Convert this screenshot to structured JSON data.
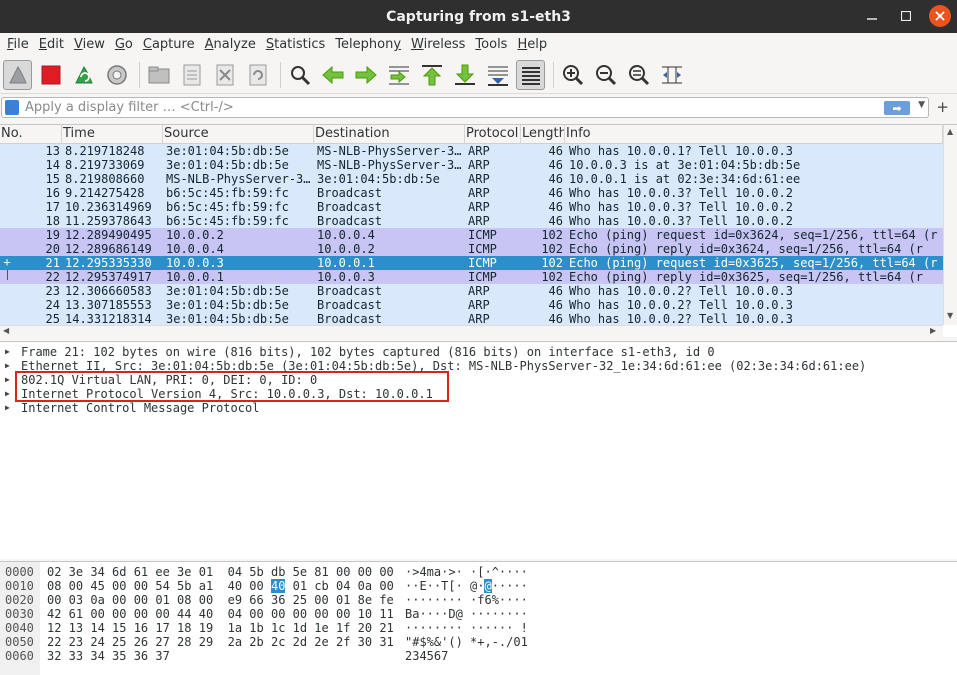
{
  "window": {
    "title": "Capturing from s1-eth3",
    "minimize_icon": "minimize-icon",
    "maximize_icon": "maximize-icon",
    "close_icon": "close-icon"
  },
  "menu": [
    {
      "label": "File",
      "mnemonic": "F",
      "rest": "ile"
    },
    {
      "label": "Edit",
      "mnemonic": "E",
      "rest": "dit"
    },
    {
      "label": "View",
      "mnemonic": "V",
      "rest": "iew"
    },
    {
      "label": "Go",
      "mnemonic": "G",
      "rest": "o"
    },
    {
      "label": "Capture",
      "mnemonic": "C",
      "rest": "apture"
    },
    {
      "label": "Analyze",
      "mnemonic": "A",
      "rest": "nalyze"
    },
    {
      "label": "Statistics",
      "mnemonic": "S",
      "rest": "tatistics"
    },
    {
      "label": "Telephony",
      "mnemonic": "y",
      "rest": "Telephon"
    },
    {
      "label": "Wireless",
      "mnemonic": "W",
      "rest": "ireless"
    },
    {
      "label": "Tools",
      "mnemonic": "T",
      "rest": "ools"
    },
    {
      "label": "Help",
      "mnemonic": "H",
      "rest": "elp"
    }
  ],
  "toolbar": {
    "icons": [
      "start-capture-icon",
      "stop-capture-icon",
      "restart-capture-icon",
      "capture-options-icon",
      "open-file-icon",
      "save-file-icon",
      "close-file-icon",
      "reload-file-icon",
      "find-packet-icon",
      "go-back-icon",
      "go-forward-icon",
      "go-to-packet-icon",
      "first-packet-icon",
      "last-packet-icon",
      "autoscroll-icon",
      "colorize-icon",
      "zoom-in-icon",
      "zoom-out-icon",
      "normal-size-icon",
      "resize-columns-icon"
    ]
  },
  "filter": {
    "placeholder": "Apply a display filter … <Ctrl-/>",
    "value": "",
    "apply_icon": "apply-filter-icon",
    "add_icon": "+"
  },
  "packet_list": {
    "columns": [
      "No.",
      "Time",
      "Source",
      "Destination",
      "Protocol",
      "Length",
      "Info"
    ],
    "rows": [
      {
        "no": "13",
        "time": "8.219718248",
        "src": "3e:01:04:5b:db:5e",
        "dst": "MS-NLB-PhysServer-3…",
        "proto": "ARP",
        "len": "46",
        "info": "Who has 10.0.0.1? Tell 10.0.0.3",
        "kind": "arp"
      },
      {
        "no": "14",
        "time": "8.219733069",
        "src": "3e:01:04:5b:db:5e",
        "dst": "MS-NLB-PhysServer-3…",
        "proto": "ARP",
        "len": "46",
        "info": "10.0.0.3 is at 3e:01:04:5b:db:5e",
        "kind": "arp"
      },
      {
        "no": "15",
        "time": "8.219808660",
        "src": "MS-NLB-PhysServer-3…",
        "dst": "3e:01:04:5b:db:5e",
        "proto": "ARP",
        "len": "46",
        "info": "10.0.0.1 is at 02:3e:34:6d:61:ee",
        "kind": "arp"
      },
      {
        "no": "16",
        "time": "9.214275428",
        "src": "b6:5c:45:fb:59:fc",
        "dst": "Broadcast",
        "proto": "ARP",
        "len": "46",
        "info": "Who has 10.0.0.3? Tell 10.0.0.2",
        "kind": "arp"
      },
      {
        "no": "17",
        "time": "10.236314969",
        "src": "b6:5c:45:fb:59:fc",
        "dst": "Broadcast",
        "proto": "ARP",
        "len": "46",
        "info": "Who has 10.0.0.3? Tell 10.0.0.2",
        "kind": "arp"
      },
      {
        "no": "18",
        "time": "11.259378643",
        "src": "b6:5c:45:fb:59:fc",
        "dst": "Broadcast",
        "proto": "ARP",
        "len": "46",
        "info": "Who has 10.0.0.3? Tell 10.0.0.2",
        "kind": "arp"
      },
      {
        "no": "19",
        "time": "12.289490495",
        "src": "10.0.0.2",
        "dst": "10.0.0.4",
        "proto": "ICMP",
        "len": "102",
        "info": "Echo (ping) request  id=0x3624, seq=1/256, ttl=64 (r",
        "kind": "icmp"
      },
      {
        "no": "20",
        "time": "12.289686149",
        "src": "10.0.0.4",
        "dst": "10.0.0.2",
        "proto": "ICMP",
        "len": "102",
        "info": "Echo (ping) reply    id=0x3624, seq=1/256, ttl=64 (r",
        "kind": "icmp"
      },
      {
        "no": "21",
        "time": "12.295335330",
        "src": "10.0.0.3",
        "dst": "10.0.0.1",
        "proto": "ICMP",
        "len": "102",
        "info": "Echo (ping) request  id=0x3625, seq=1/256, ttl=64 (r",
        "kind": "sel"
      },
      {
        "no": "22",
        "time": "12.295374917",
        "src": "10.0.0.1",
        "dst": "10.0.0.3",
        "proto": "ICMP",
        "len": "102",
        "info": "Echo (ping) reply    id=0x3625, seq=1/256, ttl=64 (r",
        "kind": "icmp"
      },
      {
        "no": "23",
        "time": "12.306660583",
        "src": "3e:01:04:5b:db:5e",
        "dst": "Broadcast",
        "proto": "ARP",
        "len": "46",
        "info": "Who has 10.0.0.2? Tell 10.0.0.3",
        "kind": "arp"
      },
      {
        "no": "24",
        "time": "13.307185553",
        "src": "3e:01:04:5b:db:5e",
        "dst": "Broadcast",
        "proto": "ARP",
        "len": "46",
        "info": "Who has 10.0.0.2? Tell 10.0.0.3",
        "kind": "arp"
      },
      {
        "no": "25",
        "time": "14.331218314",
        "src": "3e:01:04:5b:db:5e",
        "dst": "Broadcast",
        "proto": "ARP",
        "len": "46",
        "info": "Who has 10.0.0.2? Tell 10.0.0.3",
        "kind": "arp"
      }
    ]
  },
  "detail": {
    "rows": [
      "Frame 21: 102 bytes on wire (816 bits), 102 bytes captured (816 bits) on interface s1-eth3, id 0",
      "Ethernet II, Src: 3e:01:04:5b:db:5e (3e:01:04:5b:db:5e), Dst: MS-NLB-PhysServer-32_1e:34:6d:61:ee (02:3e:34:6d:61:ee)",
      "802.1Q Virtual LAN, PRI: 0, DEI: 0, ID: 0",
      "Internet Protocol Version 4, Src: 10.0.0.3, Dst: 10.0.0.1",
      "Internet Control Message Protocol"
    ],
    "highlight_color": "#d9231f"
  },
  "bytes": {
    "rows": [
      {
        "off": "0000",
        "hex": "02 3e 34 6d 61 ee 3e 01  04 5b db 5e 81 00 00 00",
        "asc": "·>4ma·>· ·[·^····"
      },
      {
        "off": "0010",
        "hex_pre": "08 00 45 00 00 54 5b a1  40 00 ",
        "hex_hl": "40",
        "hex_post": " 01 cb 04 0a 00",
        "asc_pre": "··E··T[· @·",
        "asc_hl": "@",
        "asc_post": "·····"
      },
      {
        "off": "0020",
        "hex": "00 03 0a 00 00 01 08 00  e9 66 36 25 00 01 8e fe",
        "asc": "········ ·f6%····"
      },
      {
        "off": "0030",
        "hex": "42 61 00 00 00 00 44 40  04 00 00 00 00 00 10 11",
        "asc": "Ba····D@ ········"
      },
      {
        "off": "0040",
        "hex": "12 13 14 15 16 17 18 19  1a 1b 1c 1d 1e 1f 20 21",
        "asc": "········ ······ !"
      },
      {
        "off": "0050",
        "hex": "22 23 24 25 26 27 28 29  2a 2b 2c 2d 2e 2f 30 31",
        "asc": "\"#$%&'() *+,-./01"
      },
      {
        "off": "0060",
        "hex": "32 33 34 35 36 37",
        "asc": "234567"
      }
    ]
  },
  "colors": {
    "arp_row": "#dae8fc",
    "icmp_row": "#c8c5f4",
    "selected_row": "#2c8ecb",
    "titlebar": "#2f2f2f",
    "close_button": "#e95420"
  }
}
